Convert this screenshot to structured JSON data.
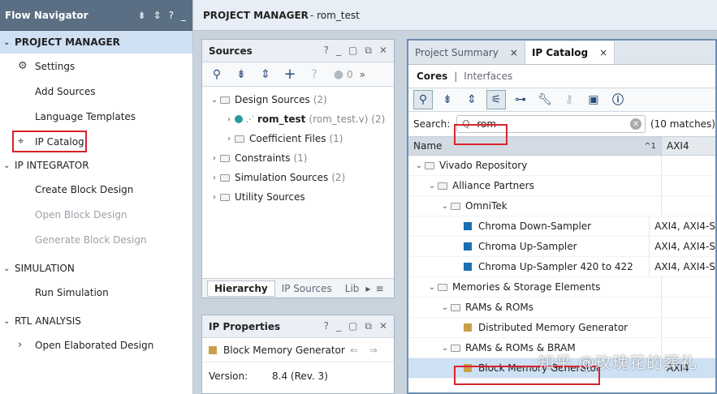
{
  "flow_navigator": {
    "title": "Flow Navigator",
    "title_icons": [
      "⇟",
      "⇕",
      "?",
      "_"
    ],
    "sections": [
      {
        "label": "PROJECT MANAGER",
        "items": [
          {
            "label": "Settings",
            "icon": "gear-icon"
          },
          {
            "label": "Add Sources"
          },
          {
            "label": "Language Templates"
          },
          {
            "label": "IP Catalog",
            "icon": "ip-plug-icon"
          }
        ]
      },
      {
        "label": "IP INTEGRATOR",
        "items": [
          {
            "label": "Create Block Design"
          },
          {
            "label": "Open Block Design"
          },
          {
            "label": "Generate Block Design"
          }
        ]
      },
      {
        "label": "SIMULATION",
        "items": [
          {
            "label": "Run Simulation"
          }
        ]
      },
      {
        "label": "RTL ANALYSIS",
        "items": [
          {
            "label": "Open Elaborated Design"
          }
        ]
      }
    ]
  },
  "project_manager_bar": {
    "bold": "PROJECT MANAGER",
    "rest": " - rom_test"
  },
  "sources": {
    "title": "Sources",
    "title_icons": [
      "?",
      "_",
      "▢",
      "⧉",
      "✕"
    ],
    "count_badge": "0",
    "tree": [
      {
        "label": "Design Sources",
        "suffix": "(2)",
        "exp": "⌄",
        "indent": 0
      },
      {
        "label": "rom_test",
        "suffix": "(rom_test.v) (2)",
        "exp": "›",
        "indent": 1
      },
      {
        "label": "Coefficient Files",
        "suffix": "(1)",
        "exp": "›",
        "indent": 1
      },
      {
        "label": "Constraints",
        "suffix": "(1)",
        "exp": "›",
        "indent": 0
      },
      {
        "label": "Simulation Sources",
        "suffix": "(2)",
        "exp": "›",
        "indent": 0
      },
      {
        "label": "Utility Sources",
        "suffix": "",
        "exp": "›",
        "indent": 0
      }
    ],
    "tabs": [
      "Hierarchy",
      "IP Sources",
      "Lib"
    ]
  },
  "ip_properties": {
    "title": "IP Properties",
    "title_icons": [
      "?",
      "_",
      "▢",
      "⧉",
      "✕"
    ],
    "selected": "Block Memory Generator",
    "version_label": "Version:",
    "version_value": "8.4 (Rev. 3)"
  },
  "ip_catalog": {
    "tabs": [
      {
        "label": "Project Summary",
        "close": "×"
      },
      {
        "label": "IP Catalog",
        "close": "×"
      }
    ],
    "subtabs": [
      "Cores",
      "Interfaces"
    ],
    "search_label": "Search:",
    "search_value": "rom",
    "search_prefix": "Q-",
    "match_count": "(10 matches)",
    "col_name": "Name",
    "col_sort": "^1",
    "col_axi": "AXI4",
    "rows": [
      {
        "label": "Vivado Repository",
        "indent": 0,
        "type": "folder",
        "axi": ""
      },
      {
        "label": "Alliance Partners",
        "indent": 1,
        "type": "folder",
        "axi": ""
      },
      {
        "label": "OmniTek",
        "indent": 2,
        "type": "folder",
        "axi": ""
      },
      {
        "label": "Chroma Down-Sampler",
        "indent": 3,
        "type": "blue",
        "axi": "AXI4, AXI4-S"
      },
      {
        "label": "Chroma Up-Sampler",
        "indent": 3,
        "type": "blue",
        "axi": "AXI4, AXI4-S"
      },
      {
        "label": "Chroma Up-Sampler 420 to 422",
        "indent": 3,
        "type": "blue",
        "axi": "AXI4, AXI4-S"
      },
      {
        "label": "Memories & Storage Elements",
        "indent": 1,
        "type": "folder",
        "axi": ""
      },
      {
        "label": "RAMs & ROMs",
        "indent": 2,
        "type": "folder",
        "axi": ""
      },
      {
        "label": "Distributed Memory Generator",
        "indent": 3,
        "type": "gold",
        "axi": ""
      },
      {
        "label": "RAMs & ROMs & BRAM",
        "indent": 2,
        "type": "folder",
        "axi": ""
      },
      {
        "label": "Block Memory Generator",
        "indent": 3,
        "type": "gold",
        "axi": "AXI4",
        "selected": true
      }
    ]
  },
  "watermark": "知乎 @玫瑰花的葬礼",
  "colors": {
    "highlight_red": "#d9232b",
    "selection_blue": "#cde0f4",
    "header_slate": "#5b6f84"
  }
}
